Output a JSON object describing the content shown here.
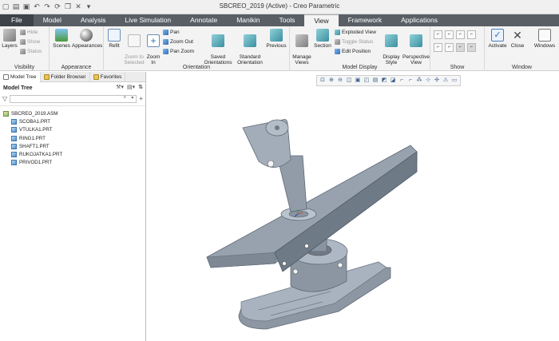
{
  "window": {
    "title": "SBCREO_2019 (Active) - Creo Parametric"
  },
  "quick_access": [
    "new-icon",
    "open-icon",
    "save-icon",
    "undo-icon",
    "redo-icon",
    "regenerate-icon",
    "windows-icon",
    "close-icon",
    "customize-icon"
  ],
  "tabs": [
    {
      "label": "File"
    },
    {
      "label": "Model"
    },
    {
      "label": "Analysis"
    },
    {
      "label": "Live Simulation"
    },
    {
      "label": "Annotate"
    },
    {
      "label": "Manikin"
    },
    {
      "label": "Tools"
    },
    {
      "label": "View"
    },
    {
      "label": "Framework"
    },
    {
      "label": "Applications"
    }
  ],
  "ribbon": {
    "visibility": {
      "label": "Visibility",
      "layers": "Layers",
      "hide": "Hide",
      "show": "Show",
      "status": "Status"
    },
    "appearance": {
      "label": "Appearance",
      "scenes": "Scenes",
      "appearances": "Appearances"
    },
    "orientation": {
      "label": "Orientation",
      "refit": "Refit",
      "zoom_to_selected": "Zoom to\nSelected",
      "zoom_in": "Zoom\nIn",
      "pan": "Pan",
      "zoom_out": "Zoom Out",
      "pan_zoom": "Pan Zoom",
      "saved": "Saved\nOrientations",
      "standard": "Standard\nOrientation",
      "previous": "Previous"
    },
    "model_display": {
      "label": "Model Display",
      "manage_views": "Manage\nViews",
      "section": "Section",
      "exploded_view": "Exploded View",
      "toggle_status": "Toggle Status",
      "edit_position": "Edit Position",
      "display_style": "Display\nStyle",
      "perspective_view": "Perspective\nView"
    },
    "show": {
      "label": "Show"
    },
    "window": {
      "label": "Window",
      "activate": "Activate",
      "close": "Close",
      "windows": "Windows"
    }
  },
  "left_panel": {
    "tabs": [
      "Model Tree",
      "Folder Browser",
      "Favorites"
    ],
    "header": "Model Tree",
    "filter_placeholder": "",
    "items": [
      {
        "label": "SBCREO_2019.ASM",
        "type": "assembly"
      },
      {
        "label": "SCOBA1.PRT",
        "type": "part"
      },
      {
        "label": "VTULKA1.PRT",
        "type": "part"
      },
      {
        "label": "RING1.PRT",
        "type": "part"
      },
      {
        "label": "SHAFT1.PRT",
        "type": "part"
      },
      {
        "label": "RUKOJATKA1.PRT",
        "type": "part"
      },
      {
        "label": "PRIVOD1.PRT",
        "type": "part"
      }
    ]
  },
  "colors": {
    "tabbar": "#5a5f66",
    "file_tab": "#3e4349",
    "ribbon": "#f3f3f3",
    "model": "#9aa5b2"
  }
}
